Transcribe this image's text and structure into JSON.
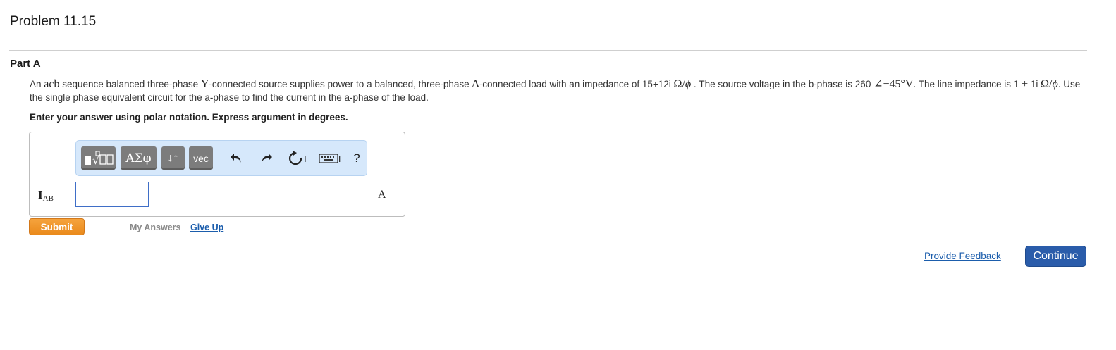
{
  "problem": {
    "title": "Problem 11.15"
  },
  "part": {
    "title": "Part A",
    "text": {
      "t1": "An ",
      "m1": "acb",
      "t2": " sequence balanced three-phase ",
      "m2": "Y",
      "t3": "-connected source supplies power to a balanced, three-phase ",
      "m3": "Δ",
      "t4": "-connected load with an impedance of 15+12i ",
      "m4": "Ω/",
      "m4b": "ϕ",
      "t5": " . The source voltage in the b-phase is 260 ",
      "m5": "∠−45°V",
      "t6": ". The line impedance is 1 ",
      "m6": "+",
      "t7": " 1i ",
      "m7": "Ω/",
      "m7b": "ϕ",
      "t8": ". Use the single phase equivalent circuit for the a-phase to find the current in the a-phase of the load."
    },
    "instruction": "Enter your answer using polar notation. Express argument in degrees."
  },
  "toolbar": {
    "greek_label": "ΑΣφ",
    "arrows_label": "↓↑",
    "vec_label": "vec",
    "help_label": "?"
  },
  "answer": {
    "variable": "I",
    "variable_sub": "AB",
    "equals": "=",
    "value": "",
    "unit": "A"
  },
  "actions": {
    "submit_label": "Submit",
    "my_answers_label": "My Answers",
    "give_up_label": "Give Up",
    "feedback_label": "Provide Feedback",
    "continue_label": "Continue"
  },
  "colors": {
    "submit": "#ea8a1c",
    "continue": "#2a5caa",
    "link": "#1b5dac",
    "toolbar_bg": "#d6e8fb"
  }
}
